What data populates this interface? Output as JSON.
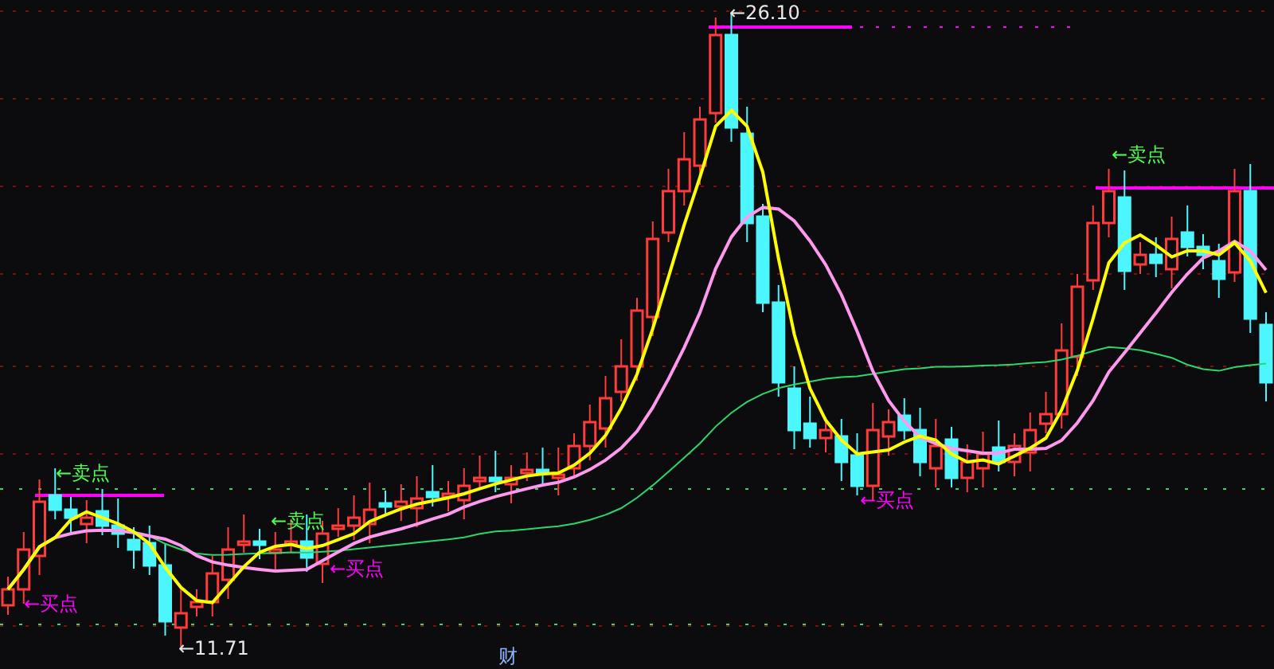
{
  "chart": {
    "price_marks": [
      "←26.10",
      "←11.71"
    ],
    "signals": [
      {
        "kind": "sell",
        "text": "←卖点"
      },
      {
        "kind": "sell",
        "text": "←卖点"
      },
      {
        "kind": "sell",
        "text": "←卖点"
      },
      {
        "kind": "buy",
        "text": "←买点"
      },
      {
        "kind": "buy",
        "text": "←买点"
      },
      {
        "kind": "buy",
        "text": "←买点"
      }
    ],
    "footer_mark": "财"
  }
}
